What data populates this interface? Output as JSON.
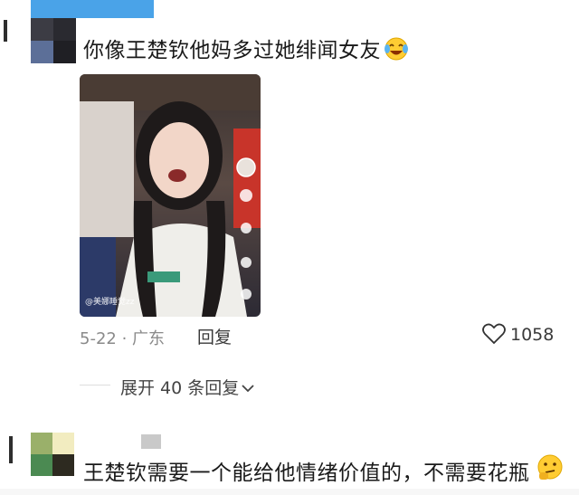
{
  "comment_top": {
    "text": "你像王楚钦他妈多过她绯闻女友",
    "emoji": "laughing-crying-emoji",
    "date_location": "5-22 · 广东",
    "reply_label": "回复",
    "like_count": "1058",
    "expand_replies": "展开 40 条回复",
    "photo": {
      "watermark": "@美娜睡觉zz",
      "description_icon": "photo-of-cheering-woman"
    }
  },
  "comment_bottom": {
    "text": "王楚钦需要一个能给他情绪价值的，不需要花瓶",
    "emoji": "thinking-emoji"
  },
  "colors": {
    "accent_blue": "#4aa3e8",
    "meta_gray": "#8a8a8a"
  }
}
